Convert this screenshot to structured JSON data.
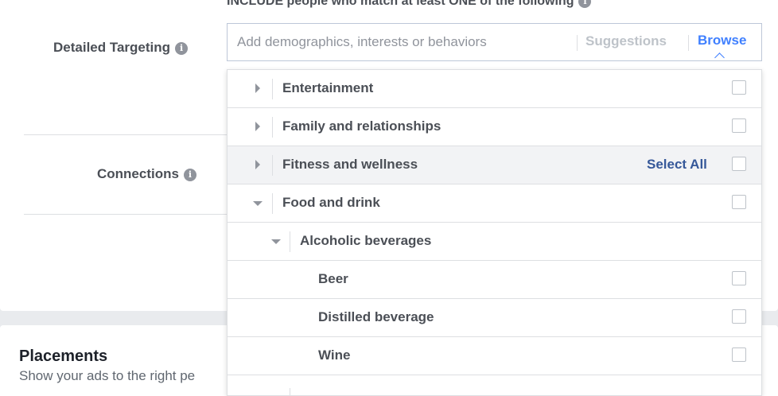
{
  "header": {
    "include_text": "INCLUDE people who match at least ONE of the following"
  },
  "left": {
    "detailed_targeting_label": "Detailed Targeting",
    "connections_label": "Connections"
  },
  "search": {
    "placeholder": "Add demographics, interests or behaviors",
    "value": "",
    "suggestions_label": "Suggestions",
    "browse_label": "Browse"
  },
  "dropdown": {
    "select_all_label": "Select All",
    "rows": [
      {
        "label": "Entertainment",
        "expanded": false
      },
      {
        "label": "Family and relationships",
        "expanded": false
      },
      {
        "label": "Fitness and wellness",
        "expanded": false
      },
      {
        "label": "Food and drink",
        "expanded": true
      },
      {
        "label": "Alcoholic beverages",
        "expanded": true
      },
      {
        "label": "Beer"
      },
      {
        "label": "Distilled beverage"
      },
      {
        "label": "Wine"
      }
    ]
  },
  "placements": {
    "title": "Placements",
    "subtitle": "Show your ads to the right pe"
  },
  "colors": {
    "accent": "#4080ff",
    "link": "#365899",
    "text": "#4b4f56"
  },
  "icons": [
    "info-icon",
    "caret-right-icon",
    "caret-down-icon",
    "checkbox-icon"
  ]
}
